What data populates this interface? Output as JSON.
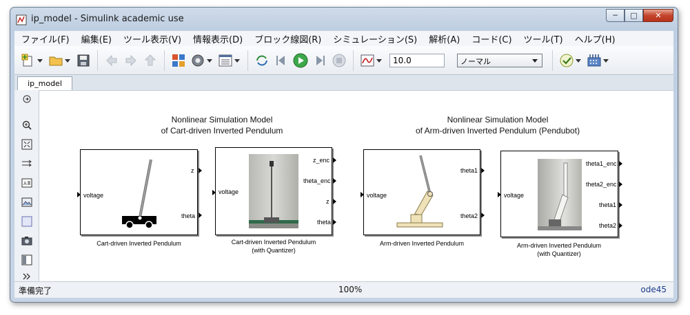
{
  "window": {
    "title": "ip_model - Simulink academic use",
    "controls": {
      "minimize": "─",
      "maximize": "□",
      "close": "✕"
    }
  },
  "menu": [
    "ファイル(F)",
    "編集(E)",
    "ツール表示(V)",
    "情報表示(D)",
    "ブロック線図(R)",
    "シミュレーション(S)",
    "解析(A)",
    "コード(C)",
    "ツール(T)",
    "ヘルプ(H)"
  ],
  "toolbar": {
    "stop_time": "10.0",
    "sim_mode": "ノーマル"
  },
  "tab": {
    "label": "ip_model"
  },
  "canvas": {
    "heading_left_line1": "Nonlinear Simulation Model",
    "heading_left_line2": "of Cart-driven Inverted Pendulum",
    "heading_right_line1": "Nonlinear Simulation Model",
    "heading_right_line2": "of Arm-driven Inverted Pendulum (Pendubot)",
    "blocks": [
      {
        "name_line1": "Cart-driven Inverted Pendulum",
        "name_line2": "",
        "input": "voltage",
        "outputs": [
          "z",
          "theta"
        ]
      },
      {
        "name_line1": "Cart-driven Inverted Pendulum",
        "name_line2": "(with Quantizer)",
        "input": "voltage",
        "outputs": [
          "z_enc",
          "theta_enc",
          "z",
          "theta"
        ]
      },
      {
        "name_line1": "Arm-driven Inverted Pendulum",
        "name_line2": "",
        "input": "voltage",
        "outputs": [
          "theta1",
          "theta2"
        ]
      },
      {
        "name_line1": "Arm-driven Inverted Pendulum",
        "name_line2": "(with Quantizer)",
        "input": "voltage",
        "outputs": [
          "theta1_enc",
          "theta2_enc",
          "theta1",
          "theta2"
        ]
      }
    ]
  },
  "status": {
    "left": "準備完了",
    "zoom": "100%",
    "solver": "ode45"
  }
}
